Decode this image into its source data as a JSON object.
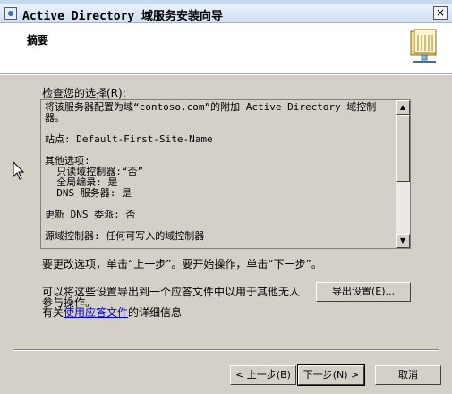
{
  "window": {
    "title": "Active Directory 域服务安装向导",
    "close_glyph": "×"
  },
  "header": {
    "title": "摘要",
    "icon": "book-icon"
  },
  "review": {
    "label": "检查您的选择(R):",
    "text": "将该服务器配置为域“contoso.com”的附加 Active Directory 域控制器。\n\n站点: Default-First-Site-Name\n\n其他选项:\n  只读域控制器:“否”\n  全局编录: 是\n  DNS 服务器: 是\n\n更新 DNS 委派: 否\n\n源域控制器: 任何可写入的域控制器"
  },
  "instructions": "要更改选项，单击“上一步”。要开始操作，单击“下一步”。",
  "export": {
    "text_line1": "可以将这些设置导出到一个应答文件中以用于其他无人",
    "text_line2": "参与操作。",
    "button_label": "导出设置(E)...",
    "more_prefix": "有关",
    "link_text": "使用应答文件",
    "more_suffix": "的详细信息"
  },
  "buttons": {
    "back": "< 上一步(B)",
    "next": "下一步(N) >",
    "cancel": "取消"
  }
}
